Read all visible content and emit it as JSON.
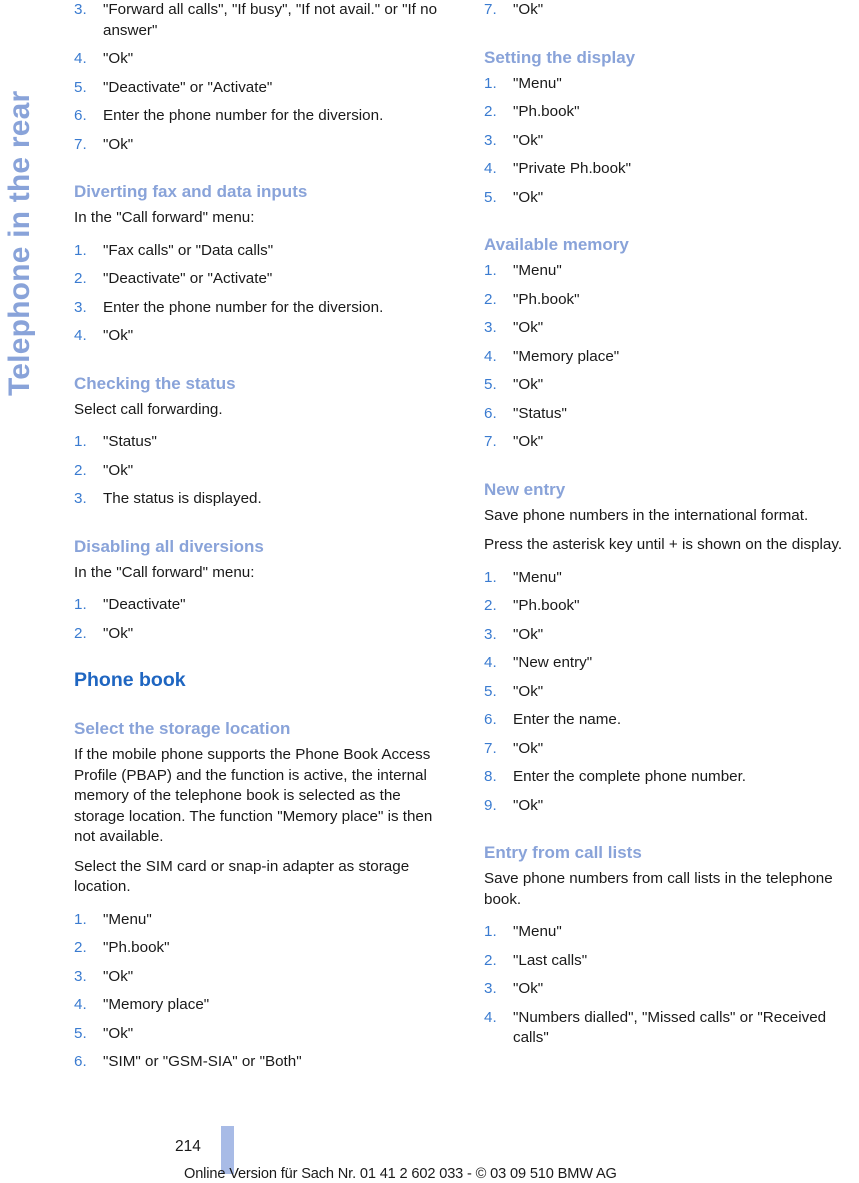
{
  "chapter_tab": {
    "label": "Telephone in the rear",
    "color": "#89a3d9"
  },
  "colors": {
    "h1": "#1f66c1",
    "h2": "#89a3d9",
    "list_number": "#3a7bd0",
    "body": "#1a1a1a",
    "footer_marker": "#a8bbe6"
  },
  "left_column": {
    "continued_list": {
      "items": [
        {
          "num": "3.",
          "text": "\"Forward all calls\", \"If busy\", \"If not avail.\" or \"If no answer\""
        },
        {
          "num": "4.",
          "text": "\"Ok\""
        },
        {
          "num": "5.",
          "text": "\"Deactivate\" or \"Activate\""
        },
        {
          "num": "6.",
          "text": "Enter the phone number for the diversion."
        },
        {
          "num": "7.",
          "text": "\"Ok\""
        }
      ]
    },
    "sections": [
      {
        "heading": "Diverting fax and data inputs",
        "level": "h2",
        "intro": "In the \"Call forward\" menu:",
        "items": [
          {
            "num": "1.",
            "text": "\"Fax calls\" or \"Data calls\""
          },
          {
            "num": "2.",
            "text": "\"Deactivate\" or \"Activate\""
          },
          {
            "num": "3.",
            "text": "Enter the phone number for the diversion."
          },
          {
            "num": "4.",
            "text": "\"Ok\""
          }
        ]
      },
      {
        "heading": "Checking the status",
        "level": "h2",
        "intro": "Select call forwarding.",
        "items": [
          {
            "num": "1.",
            "text": "\"Status\""
          },
          {
            "num": "2.",
            "text": "\"Ok\""
          },
          {
            "num": "3.",
            "text": "The status is displayed."
          }
        ]
      },
      {
        "heading": "Disabling all diversions",
        "level": "h2",
        "intro": "In the \"Call forward\" menu:",
        "items": [
          {
            "num": "1.",
            "text": "\"Deactivate\""
          },
          {
            "num": "2.",
            "text": "\"Ok\""
          }
        ]
      },
      {
        "heading": "Phone book",
        "level": "h1",
        "intro": "",
        "items": []
      },
      {
        "heading": "Select the storage location",
        "level": "h2",
        "intro": "If the mobile phone supports the Phone Book Access Profile (PBAP) and the function is active, the internal memory of the telephone book is selected as the storage location. The function \"Memory place\" is then not available.",
        "intro2": "Select the SIM card or snap-in adapter as storage location.",
        "items": [
          {
            "num": "1.",
            "text": "\"Menu\""
          },
          {
            "num": "2.",
            "text": "\"Ph.book\""
          },
          {
            "num": "3.",
            "text": "\"Ok\""
          },
          {
            "num": "4.",
            "text": "\"Memory place\""
          },
          {
            "num": "5.",
            "text": "\"Ok\""
          },
          {
            "num": "6.",
            "text": "\"SIM\" or \"GSM-SIA\" or \"Both\""
          }
        ]
      }
    ]
  },
  "right_column": {
    "continued_list": {
      "items": [
        {
          "num": "7.",
          "text": "\"Ok\""
        }
      ]
    },
    "sections": [
      {
        "heading": "Setting the display",
        "level": "h2",
        "intro": "",
        "items": [
          {
            "num": "1.",
            "text": "\"Menu\""
          },
          {
            "num": "2.",
            "text": "\"Ph.book\""
          },
          {
            "num": "3.",
            "text": "\"Ok\""
          },
          {
            "num": "4.",
            "text": "\"Private Ph.book\""
          },
          {
            "num": "5.",
            "text": "\"Ok\""
          }
        ]
      },
      {
        "heading": "Available memory",
        "level": "h2",
        "intro": "",
        "items": [
          {
            "num": "1.",
            "text": "\"Menu\""
          },
          {
            "num": "2.",
            "text": "\"Ph.book\""
          },
          {
            "num": "3.",
            "text": "\"Ok\""
          },
          {
            "num": "4.",
            "text": "\"Memory place\""
          },
          {
            "num": "5.",
            "text": "\"Ok\""
          },
          {
            "num": "6.",
            "text": "\"Status\""
          },
          {
            "num": "7.",
            "text": "\"Ok\""
          }
        ]
      },
      {
        "heading": "New entry",
        "level": "h2",
        "intro": "Save phone numbers in the international format.",
        "intro2": "Press the asterisk key until + is shown on the display.",
        "items": [
          {
            "num": "1.",
            "text": "\"Menu\""
          },
          {
            "num": "2.",
            "text": "\"Ph.book\""
          },
          {
            "num": "3.",
            "text": "\"Ok\""
          },
          {
            "num": "4.",
            "text": "\"New entry\""
          },
          {
            "num": "5.",
            "text": "\"Ok\""
          },
          {
            "num": "6.",
            "text": "Enter the name."
          },
          {
            "num": "7.",
            "text": "\"Ok\""
          },
          {
            "num": "8.",
            "text": "Enter the complete phone number."
          },
          {
            "num": "9.",
            "text": "\"Ok\""
          }
        ]
      },
      {
        "heading": "Entry from call lists",
        "level": "h2",
        "intro": "Save phone numbers from call lists in the telephone book.",
        "items": [
          {
            "num": "1.",
            "text": "\"Menu\""
          },
          {
            "num": "2.",
            "text": "\"Last calls\""
          },
          {
            "num": "3.",
            "text": "\"Ok\""
          },
          {
            "num": "4.",
            "text": "\"Numbers dialled\", \"Missed calls\" or \"Received calls\""
          }
        ]
      }
    ]
  },
  "footer": {
    "page_number": "214",
    "note": "Online Version für Sach Nr. 01 41 2 602 033 - © 03 09 510 BMW AG"
  }
}
